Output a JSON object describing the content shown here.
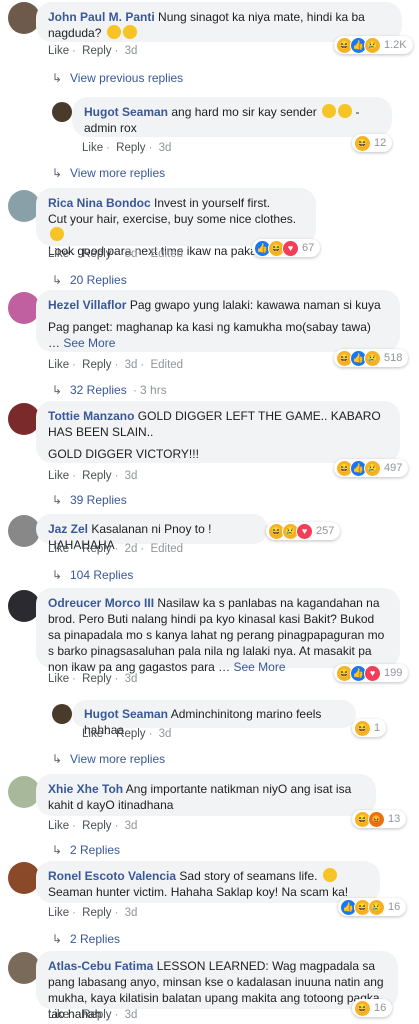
{
  "ui": {
    "like": "Like",
    "reply": "Reply",
    "edited": "Edited",
    "see_more": "See More",
    "sep": "·"
  },
  "comments": [
    {
      "name": "John Paul M. Panti",
      "text1": "Nung sinagot ka niya mate, hindi ka ba nagduda?",
      "time": "3d",
      "reactions": "1.2K"
    },
    {
      "view_prev": "View previous replies"
    },
    {
      "name": "Hugot Seaman",
      "text1": "ang hard mo sir kay sender",
      "text2": "-admin rox",
      "time": "3d",
      "reactions": "12"
    },
    {
      "view_more": "View more replies"
    },
    {
      "name": "Rica Nina Bondoc",
      "text1": "Invest in yourself first.",
      "text2": "Cut your hair, exercise, buy some nice clothes.",
      "text3": "Look good para next time ikaw na pakasalan.",
      "time": "3d",
      "reactions": "67",
      "replies": "20 Replies"
    },
    {
      "name": "Hezel Villaflor",
      "text1": "Pag gwapo yung lalaki: kawawa naman si kuya",
      "text2": "Pag panget: maghanap ka kasi ng kamukha mo(sabay tawa)",
      "text3": "…",
      "time": "3d",
      "reactions": "518",
      "replies": "32 Replies",
      "replies_time": "3 hrs"
    },
    {
      "name": "Tottie Manzano",
      "text1": "GOLD DIGGER LEFT THE GAME.. KABARO HAS BEEN SLAIN..",
      "text2": "GOLD DIGGER VICTORY!!!",
      "time": "3d",
      "reactions": "497",
      "replies": "39 Replies"
    },
    {
      "name": "Jaz Zel",
      "text1": "Kasalanan ni Pnoy to ! HAHAHAHA",
      "time": "2d",
      "reactions": "257",
      "replies": "104 Replies"
    },
    {
      "name": "Odreucer Morco III",
      "text1": "Nasilaw ka s panlabas na kagandahan na brod. Pero Buti nalang hindi pa kyo kinasal kasi Bakit? Bukod sa pinapadala mo s kanya lahat ng perang pinagpapaguran mo s barko pinagsasaluhan pala nila ng lalaki nya. At masakit pa non ikaw pa ang gagastos para …",
      "time": "3d",
      "reactions": "199"
    },
    {
      "name": "Hugot Seaman",
      "text1": "Adminchinitong marino feels hahhaa",
      "time": "3d",
      "reactions": "1",
      "view_more": "View more replies"
    },
    {
      "name": "Xhie Xhe Toh",
      "text1": "Ang importante natikman niyO ang isat isa kahit d kayO itinadhana",
      "time": "3d",
      "reactions": "13",
      "replies": "2 Replies"
    },
    {
      "name": "Ronel Escoto Valencia",
      "text1": "Sad story of seamans life.",
      "text2": "Seaman hunter victim. Hahaha Saklap koy! Na scam ka!",
      "time": "3d",
      "reactions": "16",
      "replies": "2 Replies"
    },
    {
      "name": "Atlas-Cebu Fatima",
      "text1": "LESSON LEARNED: Wag magpadala sa pang labasang anyo, minsan kse o kadalasan inuuna natin ang mukha, kaya kilatisin balatan upang makita ang totoong pagka tao hahah",
      "time": "3d",
      "reactions": "16"
    }
  ]
}
